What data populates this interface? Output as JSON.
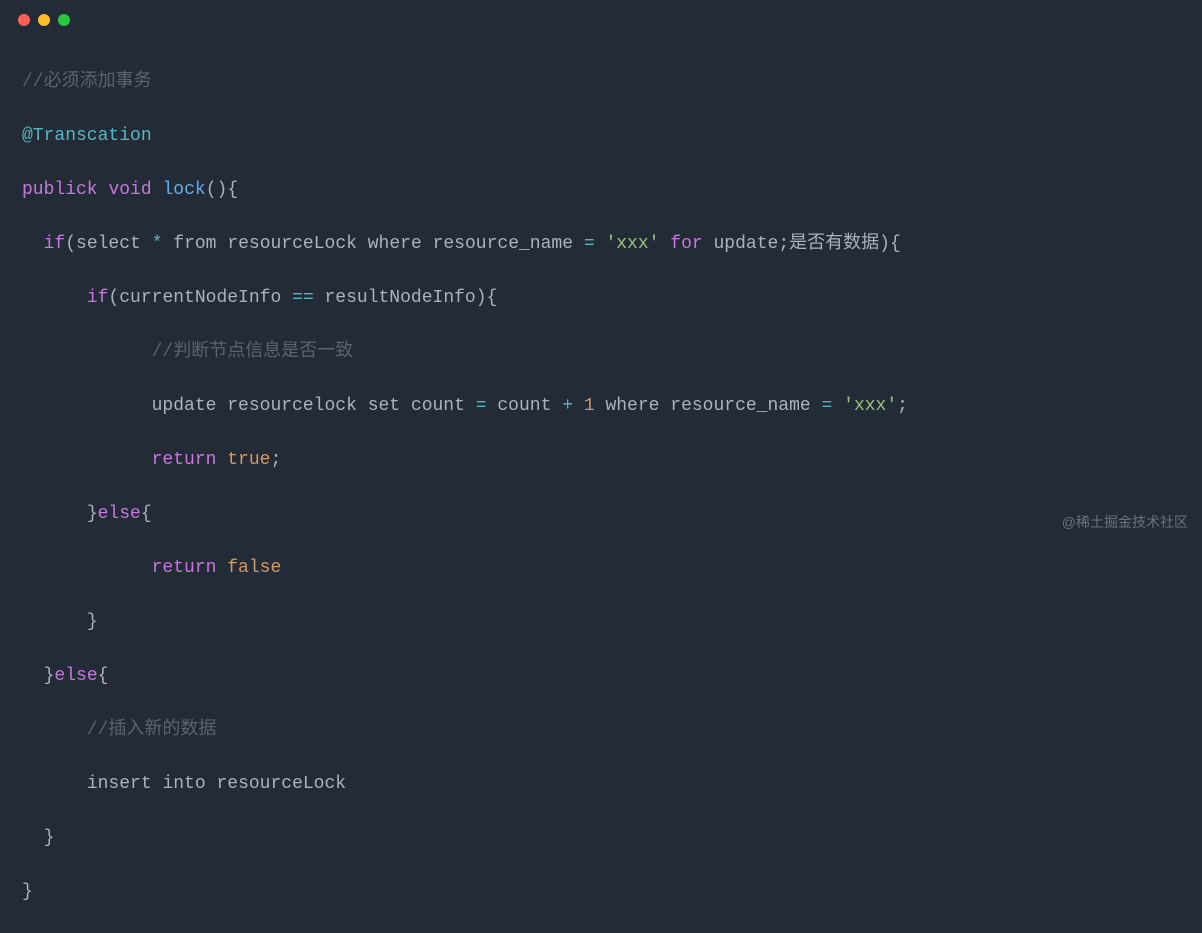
{
  "watermark": "@稀土掘金技术社区",
  "code": {
    "l1_comment": "//必须添加事务",
    "l2_annotation": "@Transcation",
    "l3": {
      "kw1": "publick",
      "type": "void",
      "fn": "lock",
      "p1": "(",
      "p2": ")",
      "br": "{"
    },
    "l4": {
      "indent": "  ",
      "kw": "if",
      "p1": "(",
      "w1": "select",
      "w2": "*",
      "w3": "from",
      "w4": "resourceLock",
      "w5": "where",
      "w6": "resource_name",
      "op": "=",
      "str": "'xxx'",
      "w7": "for",
      "w8": "update",
      "semi": ";",
      "cn": "是否有数据",
      "p2": ")",
      "br": "{"
    },
    "l5": {
      "indent": "      ",
      "kw": "if",
      "p1": "(",
      "w1": "currentNodeInfo",
      "op": "==",
      "w2": "resultNodeInfo",
      "p2": ")",
      "br": "{"
    },
    "l6": {
      "indent": "            ",
      "comment": "//判断节点信息是否一致"
    },
    "l7": {
      "indent": "            ",
      "w1": "update",
      "w2": "resourcelock",
      "w3": "set",
      "w4": "count",
      "op1": "=",
      "w5": "count",
      "op2": "+",
      "num": "1",
      "w6": "where",
      "w7": "resource_name",
      "op3": "=",
      "str": "'xxx'",
      "semi": ";"
    },
    "l8": {
      "indent": "            ",
      "kw": "return",
      "val": "true",
      "semi": ";"
    },
    "l9": {
      "indent": "      ",
      "br1": "}",
      "kw": "else",
      "br2": "{"
    },
    "l10": {
      "indent": "            ",
      "kw": "return",
      "val": "false"
    },
    "l11": {
      "indent": "      ",
      "br": "}"
    },
    "l12": {
      "indent": "  ",
      "br1": "}",
      "kw": "else",
      "br2": "{"
    },
    "l13": {
      "indent": "      ",
      "comment": "//插入新的数据"
    },
    "l14": {
      "indent": "      ",
      "w1": "insert",
      "w2": "into",
      "w3": "resourceLock"
    },
    "l15": {
      "indent": "  ",
      "br": "}"
    },
    "l16": {
      "br": "}"
    }
  }
}
